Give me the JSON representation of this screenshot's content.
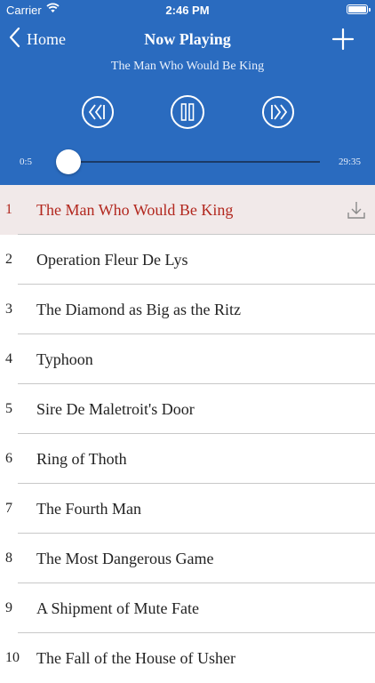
{
  "status": {
    "carrier": "Carrier",
    "time": "2:46 PM"
  },
  "nav": {
    "back_label": "Home",
    "title": "Now Playing"
  },
  "player": {
    "current_title": "The Man Who Would Be King",
    "elapsed": "0:5",
    "duration": "29:35",
    "progress_fraction": 0.003
  },
  "tracks": [
    {
      "num": "1",
      "title": "The Man Who Would Be King"
    },
    {
      "num": "2",
      "title": "Operation Fleur De Lys"
    },
    {
      "num": "3",
      "title": "The Diamond as Big as the Ritz"
    },
    {
      "num": "4",
      "title": "Typhoon"
    },
    {
      "num": "5",
      "title": "Sire De Maletroit's Door"
    },
    {
      "num": "6",
      "title": "Ring of Thoth"
    },
    {
      "num": "7",
      "title": "The Fourth Man"
    },
    {
      "num": "8",
      "title": "The Most Dangerous Game"
    },
    {
      "num": "9",
      "title": "A Shipment of Mute Fate"
    },
    {
      "num": "10",
      "title": "The Fall of the House of Usher"
    }
  ],
  "colors": {
    "header": "#2a6bbf",
    "active_text": "#b2271e",
    "active_bg": "#f1e9e9"
  }
}
